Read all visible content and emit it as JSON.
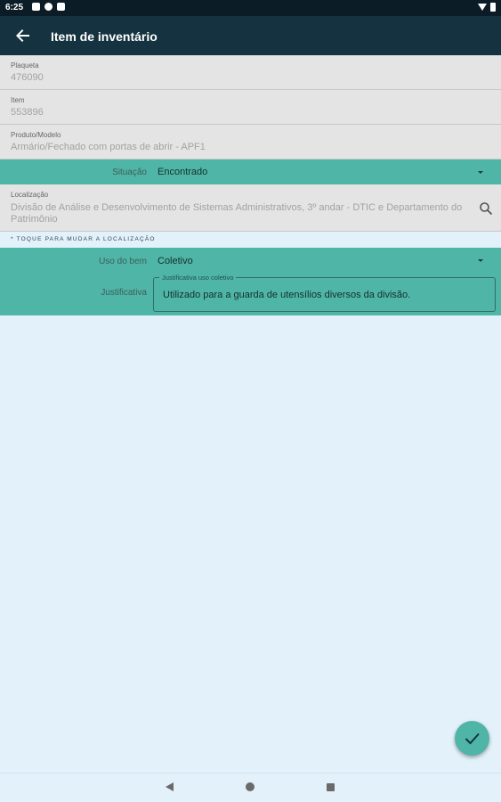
{
  "status_bar": {
    "time": "6:25"
  },
  "app_bar": {
    "title": "Item de inventário"
  },
  "fields": {
    "plaqueta": {
      "label": "Plaqueta",
      "value": "476090"
    },
    "item": {
      "label": "Item",
      "value": "553896"
    },
    "produto": {
      "label": "Produto/Modelo",
      "value": "Armário/Fechado com portas de abrir - APF1"
    }
  },
  "situacao": {
    "label": "Situação",
    "value": "Encontrado"
  },
  "localizacao": {
    "label": "Localização",
    "value": "Divisão de Análise e Desenvolvimento de Sistemas Administrativos, 3º andar - DTIC e Departamento do Patrimônio"
  },
  "hint": "* TOQUE PARA MUDAR A LOCALIZAÇÃO",
  "uso": {
    "label": "Uso do bem",
    "value": "Coletivo"
  },
  "justificativa": {
    "label": "Justificativa",
    "legend": "Justificativa uso coletivo",
    "value": "Utilizado para a guarda de utensílios diversos da divisão."
  },
  "icons": {
    "back": "arrow-left-icon",
    "search": "search-icon",
    "confirm": "check-icon",
    "dropdown": "dropdown-arrow-icon"
  },
  "colors": {
    "app_bar": "#14323f",
    "teal": "#4fb5a7",
    "background": "#e3f1fb",
    "field_bg": "#e4e4e4"
  }
}
